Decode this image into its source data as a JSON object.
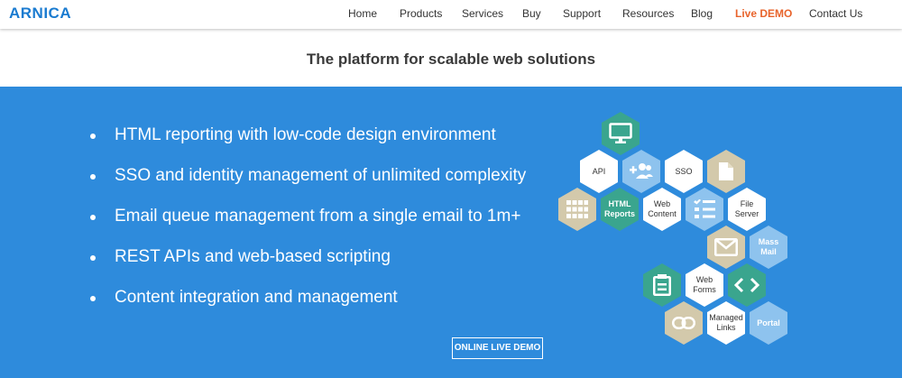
{
  "brand": {
    "logo": "ARNICA",
    "color": "#1a7bd0"
  },
  "nav": {
    "items": [
      "Home",
      "Products",
      "Services",
      "Buy",
      "Support",
      "Resources",
      "Blog",
      "Live DEMO",
      "Contact Us"
    ],
    "highlight_color": "#e8642c"
  },
  "tagline": "The platform for scalable web solutions",
  "hero": {
    "background": "#2e8bdc",
    "features": [
      "HTML reporting with low-code design environment",
      "SSO and identity management of unlimited complexity",
      "Email queue management from a single email to 1m+",
      "REST APIs and web-based scripting",
      "Content integration and management"
    ],
    "cta_label": "ONLINE LIVE DEMO"
  },
  "hex_colors": {
    "white": "#ffffff",
    "teal": "#3aa58e",
    "light_blue": "#8ec3ee",
    "beige": "#d3c9ab"
  },
  "hexes": [
    {
      "label": "",
      "icon": "monitor-icon"
    },
    {
      "label": "API",
      "icon": ""
    },
    {
      "label": "",
      "icon": "add-users-icon"
    },
    {
      "label": "SSO",
      "icon": ""
    },
    {
      "label": "",
      "icon": "document-icon"
    },
    {
      "label": "",
      "icon": "grid-icon"
    },
    {
      "label": "HTML\nReports",
      "icon": ""
    },
    {
      "label": "Web\nContent",
      "icon": ""
    },
    {
      "label": "",
      "icon": "checklist-icon"
    },
    {
      "label": "File\nServer",
      "icon": ""
    },
    {
      "label": "",
      "icon": "mail-icon"
    },
    {
      "label": "Mass\nMail",
      "icon": ""
    },
    {
      "label": "",
      "icon": "form-icon"
    },
    {
      "label": "Web\nForms",
      "icon": ""
    },
    {
      "label": "",
      "icon": "code-icon"
    },
    {
      "label": "",
      "icon": "link-icon"
    },
    {
      "label": "Managed\nLinks",
      "icon": ""
    },
    {
      "label": "Portal",
      "icon": ""
    }
  ]
}
